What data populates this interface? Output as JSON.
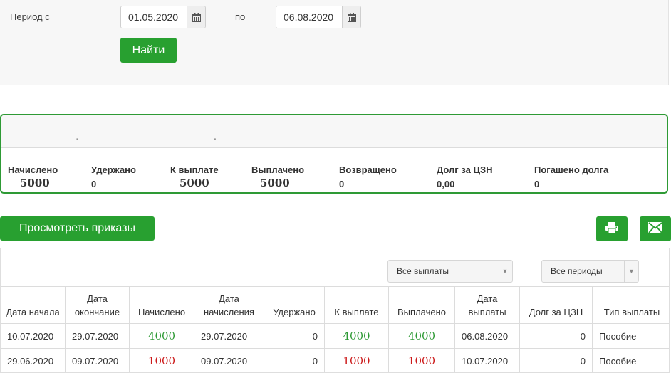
{
  "filter": {
    "period_from_label": "Период с",
    "date_from": "01.05.2020",
    "period_to_label": "по",
    "date_to": "06.08.2020",
    "find_button": "Найти"
  },
  "summary": {
    "separator_1": "-",
    "separator_2": "-",
    "items": [
      {
        "label": "Начислено",
        "value": "5000"
      },
      {
        "label": "Удержано",
        "value": "0"
      },
      {
        "label": "К выплате",
        "value": "5000"
      },
      {
        "label": "Выплачено",
        "value": "5000"
      },
      {
        "label": "Возвращено",
        "value": "0"
      },
      {
        "label": "Долг за ЦЗН",
        "value": "0,00"
      },
      {
        "label": "Погашено долга",
        "value": "0"
      }
    ]
  },
  "actions": {
    "view_orders_button": "Просмотреть приказы",
    "print_icon": "printer-icon",
    "mail_icon": "envelope-icon"
  },
  "table": {
    "payments_filter": "Все выплаты",
    "periods_filter": "Все периоды",
    "headers": [
      "Дата начала",
      "Дата окончание",
      "Начислено",
      "Дата начисления",
      "Удержано",
      "К выплате",
      "Выплачено",
      "Дата выплаты",
      "Долг за ЦЗН",
      "Тип выплаты"
    ],
    "rows": [
      {
        "start": "10.07.2020",
        "end": "29.07.2020",
        "accrued": "4000",
        "accrual_date": "29.07.2020",
        "withheld": "0",
        "to_pay": "4000",
        "paid": "4000",
        "pay_date": "06.08.2020",
        "debt": "0",
        "type": "Пособие"
      },
      {
        "start": "29.06.2020",
        "end": "09.07.2020",
        "accrued": "1000",
        "accrual_date": "09.07.2020",
        "withheld": "0",
        "to_pay": "1000",
        "paid": "1000",
        "pay_date": "10.07.2020",
        "debt": "0",
        "type": "Пособие"
      }
    ]
  },
  "colors": {
    "accent_green": "#28a030",
    "amount_green": "#2e9a35",
    "amount_red": "#cc1b1b"
  }
}
